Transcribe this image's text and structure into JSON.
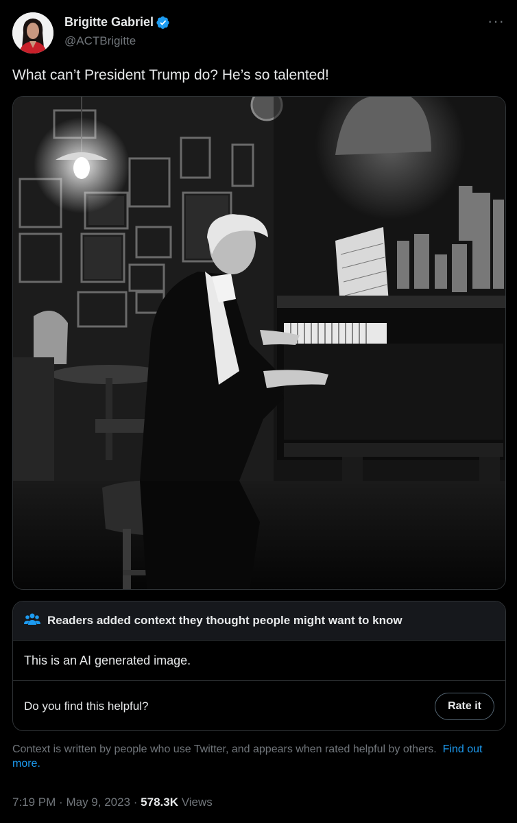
{
  "author": {
    "display_name": "Brigitte Gabriel",
    "handle": "@ACTBrigitte",
    "verified": true,
    "verified_icon": "verified-badge-icon"
  },
  "tweet": {
    "text": "What can’t President Trump do? He’s so talented!",
    "media_description": "Black and white photo of a man in a tuxedo playing an upright piano in a dimly lit bar"
  },
  "community_note": {
    "header": "Readers added context they thought people might want to know",
    "header_icon": "people-icon",
    "body": "This is an AI generated image.",
    "question": "Do you find this helpful?",
    "rate_button": "Rate it",
    "context_text": "Context is written by people who use Twitter, and appears when rated helpful by others.",
    "find_out_more": "Find out more."
  },
  "meta": {
    "time": "7:19 PM",
    "sep1": "·",
    "date": "May 9, 2023",
    "sep2": "·",
    "views_count": "578.3K",
    "views_label": "Views"
  },
  "colors": {
    "background": "#000000",
    "text_primary": "#e7e9ea",
    "text_secondary": "#71767b",
    "accent": "#1d9bf0",
    "border": "#2f3336"
  }
}
